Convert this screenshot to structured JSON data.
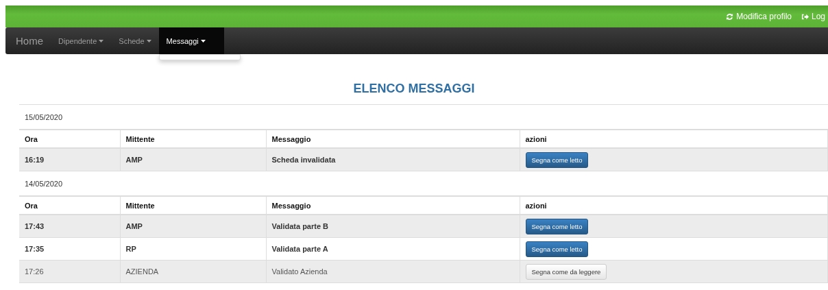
{
  "topbar": {
    "links": [
      {
        "label": "Modifica profilo",
        "kind": "refresh"
      },
      {
        "label": "Log",
        "kind": "logout"
      }
    ]
  },
  "navbar": {
    "items": [
      {
        "label": "Home",
        "dropdown": false,
        "selected": false
      },
      {
        "label": "Dipendente",
        "dropdown": true,
        "selected": false
      },
      {
        "label": "Schede",
        "dropdown": true,
        "selected": false
      },
      {
        "label": "Messaggi",
        "dropdown": true,
        "selected": true
      }
    ]
  },
  "title": "ELENCO MESSAGGI",
  "groups": [
    {
      "date": "15/05/2020",
      "columns": [
        "Ora",
        "Mittente",
        "Messaggio",
        "azioni"
      ],
      "messages": [
        {
          "time": "16:19",
          "sender": "AMP",
          "message": "Scheda invalidata",
          "read": false,
          "action": "Segna come letto"
        }
      ]
    },
    {
      "date": "14/05/2020",
      "columns": [
        "Ora",
        "Mittente",
        "Messaggio",
        "azioni"
      ],
      "messages": [
        {
          "time": "17:43",
          "sender": "AMP",
          "message": "Validata parte B",
          "read": false,
          "action": "Segna come letto"
        },
        {
          "time": "17:35",
          "sender": "RP",
          "message": "Validata parte A",
          "read": false,
          "action": "Segna come letto"
        },
        {
          "time": "17:26",
          "sender": "AZIENDA",
          "message": "Validato Azienda",
          "read": true,
          "action": "Segna come da leggere"
        }
      ]
    }
  ]
}
